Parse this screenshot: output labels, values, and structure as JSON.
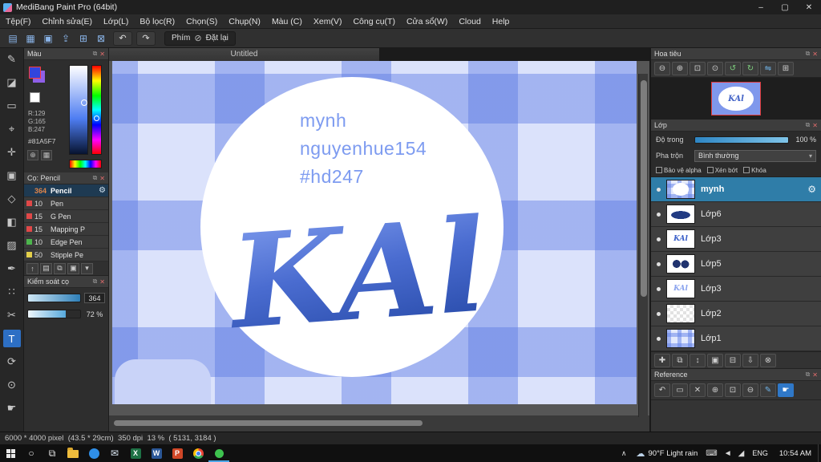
{
  "window": {
    "title": "MediBang Paint Pro (64bit)",
    "min": "–",
    "max": "▢",
    "close": "✕"
  },
  "menu_items": [
    "Tệp(F)",
    "Chỉnh sửa(E)",
    "Lớp(L)",
    "Bộ lọc(R)",
    "Chọn(S)",
    "Chụp(N)",
    "Màu (C)",
    "Xem(V)",
    "Công cụ(T)",
    "Cửa sổ(W)",
    "Cloud",
    "Help"
  ],
  "toolbar": {
    "icons": [
      {
        "n": "new-file-icon",
        "g": "▤"
      },
      {
        "n": "save-icon",
        "g": "▦"
      },
      {
        "n": "open-icon",
        "g": "▣"
      },
      {
        "n": "export-icon",
        "g": "⇪"
      },
      {
        "n": "grid-icon",
        "g": "⊞"
      },
      {
        "n": "snap-icon",
        "g": "⊠"
      }
    ],
    "undo": "↶",
    "redo": "↷",
    "key_label": "Phím",
    "reset_icon": "⊘",
    "reset_label": "Đặt lại"
  },
  "icons": {
    "panel": {
      "pop": "⧉",
      "close": "✕"
    },
    "toolstrip": [
      {
        "n": "pen-tool",
        "g": "✎"
      },
      {
        "n": "eraser-tool",
        "g": "◪"
      },
      {
        "n": "select-tool",
        "g": "▭"
      },
      {
        "n": "wand-tool",
        "g": "⌖"
      },
      {
        "n": "move-tool",
        "g": "✛"
      },
      {
        "n": "shape-tool",
        "g": "▣"
      },
      {
        "n": "lasso-tool",
        "g": "◇"
      },
      {
        "n": "bucket-tool",
        "g": "◧"
      },
      {
        "n": "gradient-tool",
        "g": "▨"
      },
      {
        "n": "select-pen-tool",
        "g": "✒"
      },
      {
        "n": "scatter-tool",
        "g": "∷"
      },
      {
        "n": "divide-tool",
        "g": "✂"
      },
      {
        "n": "text-tool",
        "g": "T",
        "selected": true
      },
      {
        "n": "rotate-tool",
        "g": "⟳"
      },
      {
        "n": "zoom-tool",
        "g": "⊙"
      },
      {
        "n": "hand-tool",
        "g": "☛"
      }
    ],
    "color_tools": [
      {
        "n": "web-color-icon",
        "g": "⊕"
      },
      {
        "n": "swatch-grid-icon",
        "g": "▦"
      }
    ]
  },
  "color_panel": {
    "title": "Màu",
    "rgb_lines": [
      "R:129",
      "G:165",
      "B:247"
    ],
    "hex": "#81A5F7",
    "current_color": "#81A5F7"
  },
  "brush_panel": {
    "title": "Cọ: Pencil",
    "items": [
      {
        "size": "364",
        "name": "Pencil",
        "selected": true
      },
      {
        "size": "10",
        "name": "Pen",
        "chip": "#e04848"
      },
      {
        "size": "15",
        "name": "G Pen",
        "chip": "#e04848"
      },
      {
        "size": "15",
        "name": "Mapping P",
        "chip": "#e04848"
      },
      {
        "size": "10",
        "name": "Edge Pen",
        "chip": "#4db54d"
      },
      {
        "size": "50",
        "name": "Stipple Pe",
        "chip": "#e3cf4a"
      }
    ],
    "toolbar": [
      {
        "n": "brush-up-icon",
        "g": "↑"
      },
      {
        "n": "brush-new-icon",
        "g": "▤"
      },
      {
        "n": "brush-copy-icon",
        "g": "⧉"
      },
      {
        "n": "brush-folder-icon",
        "g": "▣"
      },
      {
        "n": "brush-menu-icon",
        "g": "▾"
      }
    ]
  },
  "brush_control": {
    "title": "Kiểm soát cọ",
    "size_value": "364",
    "opacity_value": "72 %"
  },
  "canvas": {
    "tab_title": "Untitled",
    "texts": [
      "mynh",
      "nguyenhue154",
      "#hd247"
    ],
    "logo_text": "KAl",
    "text_color": "#7d9bf0"
  },
  "navigator": {
    "title": "Hoa tiêu",
    "toolbar": [
      {
        "n": "zoom-out-icon",
        "g": "⊖"
      },
      {
        "n": "zoom-in-icon",
        "g": "⊕"
      },
      {
        "n": "fit-icon",
        "g": "⊡"
      },
      {
        "n": "actual-size-icon",
        "g": "⊙"
      },
      {
        "n": "rotate-ccw-icon",
        "g": "↺",
        "c": "#7fd17f"
      },
      {
        "n": "rotate-cw-icon",
        "g": "↻",
        "c": "#7fd17f"
      },
      {
        "n": "flip-icon",
        "g": "⇋",
        "c": "#6fb3e8"
      },
      {
        "n": "reset-view-icon",
        "g": "⊞"
      }
    ]
  },
  "layers": {
    "title": "Lớp",
    "opacity_label": "Độ trong",
    "opacity_value": "100 %",
    "blend_label": "Pha trộn",
    "blend_value": "Bình thường",
    "blend_caret": "▾",
    "checkboxes": [
      "Bảo vệ alpha",
      "Xén bớt",
      "Khóa"
    ],
    "items": [
      {
        "name": "mynh",
        "selected": true,
        "thumb": "plaidellipse"
      },
      {
        "name": "Lớp6",
        "thumb": "scribble"
      },
      {
        "name": "Lớp3",
        "thumb": "kal",
        "tl": "KAl"
      },
      {
        "name": "Lớp5",
        "thumb": "blobs"
      },
      {
        "name": "Lớp3",
        "thumb": "kal2",
        "tl": "KAl"
      },
      {
        "name": "Lớp2",
        "thumb": "checker"
      },
      {
        "name": "Lớp1",
        "thumb": "plaid"
      }
    ],
    "gear": "⚙",
    "toolbar": [
      {
        "n": "new-layer-icon",
        "g": "✚"
      },
      {
        "n": "duplicate-layer-icon",
        "g": "⧉"
      },
      {
        "n": "layer-order-icon",
        "g": "↕"
      },
      {
        "n": "layer-folder-icon",
        "g": "▣"
      },
      {
        "n": "merge-layer-icon",
        "g": "⊟"
      },
      {
        "n": "transfer-layer-icon",
        "g": "⇩"
      },
      {
        "n": "delete-layer-icon",
        "g": "⊗"
      }
    ]
  },
  "reference": {
    "title": "Reference",
    "toolbar": [
      {
        "n": "back-icon",
        "g": "↶"
      },
      {
        "n": "select-area-icon",
        "g": "▭"
      },
      {
        "n": "clear-icon",
        "g": "✕"
      },
      {
        "n": "zoom-in-icon",
        "g": "⊕"
      },
      {
        "n": "fit-icon",
        "g": "⊡"
      },
      {
        "n": "zoom-out-icon",
        "g": "⊖"
      },
      {
        "n": "eyedropper-icon",
        "g": "✎",
        "c": "#6fb3e8"
      },
      {
        "n": "hand-icon",
        "g": "☛",
        "selected": true
      }
    ]
  },
  "status": {
    "text": "6000 * 4000 pixel  (43.5 * 29cm)  350 dpi  13 %  ( 5131, 3184 )"
  },
  "taskbar": {
    "search_icon": "○",
    "taskview_icon": "⧉",
    "apps": [
      {
        "n": "file-explorer-icon",
        "cls": "ic-folder"
      },
      {
        "n": "messenger-app-icon",
        "cls": "ic-bluecircle"
      },
      {
        "n": "mail-app-icon",
        "g": "✉"
      },
      {
        "n": "excel-icon",
        "letter": "X",
        "bg": "#1e7145"
      },
      {
        "n": "word-icon",
        "letter": "W",
        "bg": "#2b5797"
      },
      {
        "n": "powerpoint-icon",
        "letter": "P",
        "bg": "#d04727"
      },
      {
        "n": "chrome-icon",
        "cls": "ic-chrome"
      },
      {
        "n": "medibang-app-icon",
        "cls": "ic-green",
        "active": true
      }
    ],
    "caret": "∧",
    "weather_icon": "☁",
    "weather": "90°F Light rain",
    "tray_icons": [
      {
        "n": "keyboard-icon",
        "g": "⌨"
      },
      {
        "n": "volume-icon",
        "g": "◄"
      },
      {
        "n": "network-icon",
        "g": "◢"
      }
    ],
    "lang": "ENG",
    "time": "10:54 AM"
  }
}
